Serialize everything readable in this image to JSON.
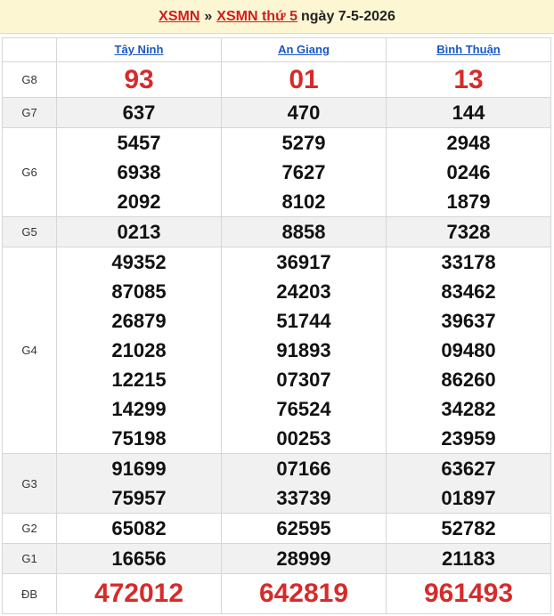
{
  "header": {
    "crumb1": "XSMN",
    "separator": "»",
    "crumb2": "XSMN thứ 5",
    "date": "ngày 7-5-2026"
  },
  "provinces": [
    "Tây Ninh",
    "An Giang",
    "Bình Thuận"
  ],
  "prizes": [
    {
      "label": "G8",
      "values": [
        [
          "93"
        ],
        [
          "01"
        ],
        [
          "13"
        ]
      ]
    },
    {
      "label": "G7",
      "values": [
        [
          "637"
        ],
        [
          "470"
        ],
        [
          "144"
        ]
      ]
    },
    {
      "label": "G6",
      "values": [
        [
          "5457",
          "6938",
          "2092"
        ],
        [
          "5279",
          "7627",
          "8102"
        ],
        [
          "2948",
          "0246",
          "1879"
        ]
      ]
    },
    {
      "label": "G5",
      "values": [
        [
          "0213"
        ],
        [
          "8858"
        ],
        [
          "7328"
        ]
      ]
    },
    {
      "label": "G4",
      "values": [
        [
          "49352",
          "87085",
          "26879",
          "21028",
          "12215",
          "14299",
          "75198"
        ],
        [
          "36917",
          "24203",
          "51744",
          "91893",
          "07307",
          "76524",
          "00253"
        ],
        [
          "33178",
          "83462",
          "39637",
          "09480",
          "86260",
          "34282",
          "23959"
        ]
      ]
    },
    {
      "label": "G3",
      "values": [
        [
          "91699",
          "75957"
        ],
        [
          "07166",
          "33739"
        ],
        [
          "63627",
          "01897"
        ]
      ]
    },
    {
      "label": "G2",
      "values": [
        [
          "65082"
        ],
        [
          "62595"
        ],
        [
          "52782"
        ]
      ]
    },
    {
      "label": "G1",
      "values": [
        [
          "16656"
        ],
        [
          "28999"
        ],
        [
          "21183"
        ]
      ]
    },
    {
      "label": "ĐB",
      "values": [
        [
          "472012"
        ],
        [
          "642819"
        ],
        [
          "961493"
        ]
      ]
    }
  ],
  "colors": {
    "accent_red": "#d62b2b",
    "link_blue": "#1a56c8",
    "header_bg": "#fdf6d3"
  }
}
